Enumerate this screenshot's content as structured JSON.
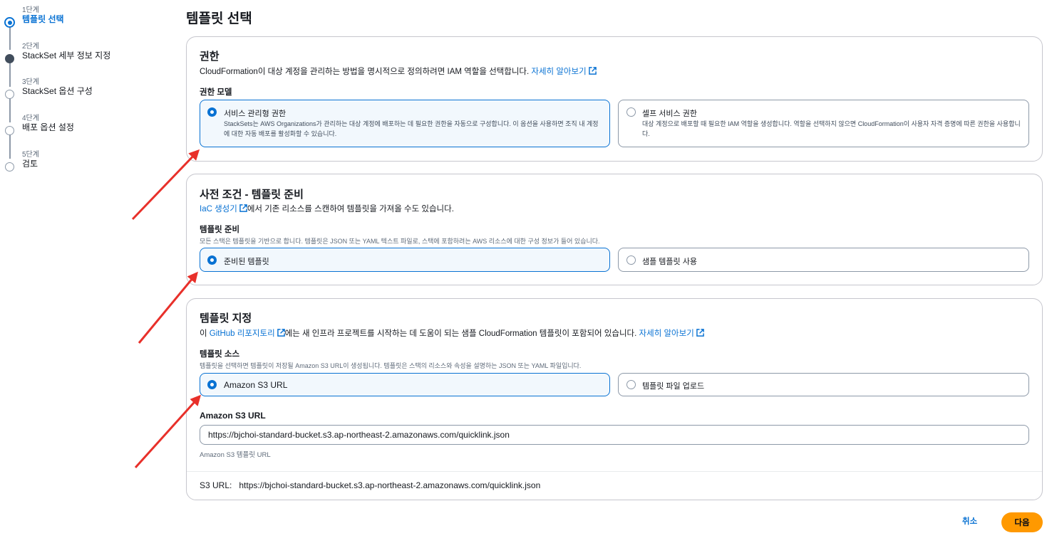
{
  "steps": [
    {
      "num": "1단계",
      "label": "템플릿 선택",
      "state": "current"
    },
    {
      "num": "2단계",
      "label": "StackSet 세부 정보 지정",
      "state": "done"
    },
    {
      "num": "3단계",
      "label": "StackSet 옵션 구성",
      "state": "todo"
    },
    {
      "num": "4단계",
      "label": "배포 옵션 설정",
      "state": "todo"
    },
    {
      "num": "5단계",
      "label": "검토",
      "state": "todo"
    }
  ],
  "page_title": "템플릿 선택",
  "permissions": {
    "title": "권한",
    "desc": "CloudFormation이 대상 계정을 관리하는 방법을 명시적으로 정의하려면 IAM 역할을 선택합니다.",
    "learn_more": "자세히 알아보기",
    "model_label": "권한 모델",
    "options": [
      {
        "label": "서비스 관리형 권한",
        "desc": "StackSets는 AWS Organizations가 관리하는 대상 계정에 배포하는 데 필요한 권한을 자동으로 구성합니다. 이 옵션을 사용하면 조직 내 계정에 대한 자동 배포를 활성화할 수 있습니다.",
        "selected": true
      },
      {
        "label": "셀프 서비스 권한",
        "desc": "대상 계정으로 배포할 때 필요한 IAM 역할을 생성합니다. 역할을 선택하지 않으면 CloudFormation이 사용자 자격 증명에 따른 권한을 사용합니다.",
        "selected": false
      }
    ]
  },
  "prereq": {
    "title": "사전 조건 - 템플릿 준비",
    "iac_link": "IaC 생성기",
    "desc_rest": "에서 기존 리소스를 스캔하여 템플릿을 가져올 수도 있습니다.",
    "field_label": "템플릿 준비",
    "field_hint": "모든 스택은 템플릿을 기반으로 합니다. 템플릿은 JSON 또는 YAML 텍스트 파일로, 스택에 포함하려는 AWS 리소스에 대한 구성 정보가 들어 있습니다.",
    "options": [
      {
        "label": "준비된 템플릿",
        "selected": true
      },
      {
        "label": "샘플 템플릿 사용",
        "selected": false
      }
    ]
  },
  "template_spec": {
    "title": "템플릿 지정",
    "desc_prefix": "이 ",
    "github_link": "GitHub 리포지토리",
    "desc_rest": "에는 새 인프라 프로젝트를 시작하는 데 도움이 되는 샘플 CloudFormation 템플릿이 포함되어 있습니다.",
    "learn_more": "자세히 알아보기",
    "source_label": "템플릿 소스",
    "source_hint": "템플릿을 선택하면 템플릿이 저장될 Amazon S3 URL이 생성됩니다. 템플릿은 스택의 리소스와 속성을 설명하는 JSON 또는 YAML 파일입니다.",
    "options": [
      {
        "label": "Amazon S3 URL",
        "selected": true
      },
      {
        "label": "템플릿 파일 업로드",
        "selected": false
      }
    ],
    "s3_label": "Amazon S3 URL",
    "s3_value": "https://bjchoi-standard-bucket.s3.ap-northeast-2.amazonaws.com/quicklink.json",
    "s3_hint": "Amazon S3 템플릿 URL",
    "summary_key": "S3 URL:",
    "summary_value": "https://bjchoi-standard-bucket.s3.ap-northeast-2.amazonaws.com/quicklink.json"
  },
  "footer": {
    "cancel": "취소",
    "next": "다음"
  },
  "colors": {
    "accent": "#0972d3",
    "primary_button": "#ff9900",
    "annotation": "#e8302a"
  }
}
